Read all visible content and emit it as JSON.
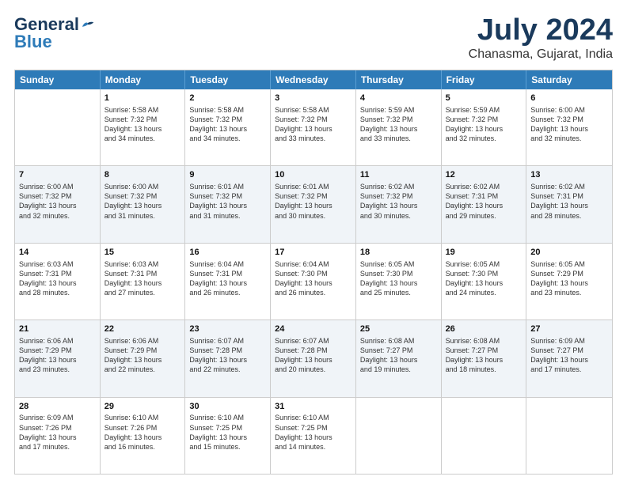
{
  "header": {
    "logo_general": "General",
    "logo_blue": "Blue",
    "month_title": "July 2024",
    "subtitle": "Chanasma, Gujarat, India"
  },
  "calendar": {
    "days_of_week": [
      "Sunday",
      "Monday",
      "Tuesday",
      "Wednesday",
      "Thursday",
      "Friday",
      "Saturday"
    ],
    "rows": [
      {
        "alt": false,
        "cells": [
          {
            "day": "",
            "info": ""
          },
          {
            "day": "1",
            "info": "Sunrise: 5:58 AM\nSunset: 7:32 PM\nDaylight: 13 hours\nand 34 minutes."
          },
          {
            "day": "2",
            "info": "Sunrise: 5:58 AM\nSunset: 7:32 PM\nDaylight: 13 hours\nand 34 minutes."
          },
          {
            "day": "3",
            "info": "Sunrise: 5:58 AM\nSunset: 7:32 PM\nDaylight: 13 hours\nand 33 minutes."
          },
          {
            "day": "4",
            "info": "Sunrise: 5:59 AM\nSunset: 7:32 PM\nDaylight: 13 hours\nand 33 minutes."
          },
          {
            "day": "5",
            "info": "Sunrise: 5:59 AM\nSunset: 7:32 PM\nDaylight: 13 hours\nand 32 minutes."
          },
          {
            "day": "6",
            "info": "Sunrise: 6:00 AM\nSunset: 7:32 PM\nDaylight: 13 hours\nand 32 minutes."
          }
        ]
      },
      {
        "alt": true,
        "cells": [
          {
            "day": "7",
            "info": "Sunrise: 6:00 AM\nSunset: 7:32 PM\nDaylight: 13 hours\nand 32 minutes."
          },
          {
            "day": "8",
            "info": "Sunrise: 6:00 AM\nSunset: 7:32 PM\nDaylight: 13 hours\nand 31 minutes."
          },
          {
            "day": "9",
            "info": "Sunrise: 6:01 AM\nSunset: 7:32 PM\nDaylight: 13 hours\nand 31 minutes."
          },
          {
            "day": "10",
            "info": "Sunrise: 6:01 AM\nSunset: 7:32 PM\nDaylight: 13 hours\nand 30 minutes."
          },
          {
            "day": "11",
            "info": "Sunrise: 6:02 AM\nSunset: 7:32 PM\nDaylight: 13 hours\nand 30 minutes."
          },
          {
            "day": "12",
            "info": "Sunrise: 6:02 AM\nSunset: 7:31 PM\nDaylight: 13 hours\nand 29 minutes."
          },
          {
            "day": "13",
            "info": "Sunrise: 6:02 AM\nSunset: 7:31 PM\nDaylight: 13 hours\nand 28 minutes."
          }
        ]
      },
      {
        "alt": false,
        "cells": [
          {
            "day": "14",
            "info": "Sunrise: 6:03 AM\nSunset: 7:31 PM\nDaylight: 13 hours\nand 28 minutes."
          },
          {
            "day": "15",
            "info": "Sunrise: 6:03 AM\nSunset: 7:31 PM\nDaylight: 13 hours\nand 27 minutes."
          },
          {
            "day": "16",
            "info": "Sunrise: 6:04 AM\nSunset: 7:31 PM\nDaylight: 13 hours\nand 26 minutes."
          },
          {
            "day": "17",
            "info": "Sunrise: 6:04 AM\nSunset: 7:30 PM\nDaylight: 13 hours\nand 26 minutes."
          },
          {
            "day": "18",
            "info": "Sunrise: 6:05 AM\nSunset: 7:30 PM\nDaylight: 13 hours\nand 25 minutes."
          },
          {
            "day": "19",
            "info": "Sunrise: 6:05 AM\nSunset: 7:30 PM\nDaylight: 13 hours\nand 24 minutes."
          },
          {
            "day": "20",
            "info": "Sunrise: 6:05 AM\nSunset: 7:29 PM\nDaylight: 13 hours\nand 23 minutes."
          }
        ]
      },
      {
        "alt": true,
        "cells": [
          {
            "day": "21",
            "info": "Sunrise: 6:06 AM\nSunset: 7:29 PM\nDaylight: 13 hours\nand 23 minutes."
          },
          {
            "day": "22",
            "info": "Sunrise: 6:06 AM\nSunset: 7:29 PM\nDaylight: 13 hours\nand 22 minutes."
          },
          {
            "day": "23",
            "info": "Sunrise: 6:07 AM\nSunset: 7:28 PM\nDaylight: 13 hours\nand 22 minutes."
          },
          {
            "day": "24",
            "info": "Sunrise: 6:07 AM\nSunset: 7:28 PM\nDaylight: 13 hours\nand 20 minutes."
          },
          {
            "day": "25",
            "info": "Sunrise: 6:08 AM\nSunset: 7:27 PM\nDaylight: 13 hours\nand 19 minutes."
          },
          {
            "day": "26",
            "info": "Sunrise: 6:08 AM\nSunset: 7:27 PM\nDaylight: 13 hours\nand 18 minutes."
          },
          {
            "day": "27",
            "info": "Sunrise: 6:09 AM\nSunset: 7:27 PM\nDaylight: 13 hours\nand 17 minutes."
          }
        ]
      },
      {
        "alt": false,
        "cells": [
          {
            "day": "28",
            "info": "Sunrise: 6:09 AM\nSunset: 7:26 PM\nDaylight: 13 hours\nand 17 minutes."
          },
          {
            "day": "29",
            "info": "Sunrise: 6:10 AM\nSunset: 7:26 PM\nDaylight: 13 hours\nand 16 minutes."
          },
          {
            "day": "30",
            "info": "Sunrise: 6:10 AM\nSunset: 7:25 PM\nDaylight: 13 hours\nand 15 minutes."
          },
          {
            "day": "31",
            "info": "Sunrise: 6:10 AM\nSunset: 7:25 PM\nDaylight: 13 hours\nand 14 minutes."
          },
          {
            "day": "",
            "info": ""
          },
          {
            "day": "",
            "info": ""
          },
          {
            "day": "",
            "info": ""
          }
        ]
      }
    ]
  }
}
